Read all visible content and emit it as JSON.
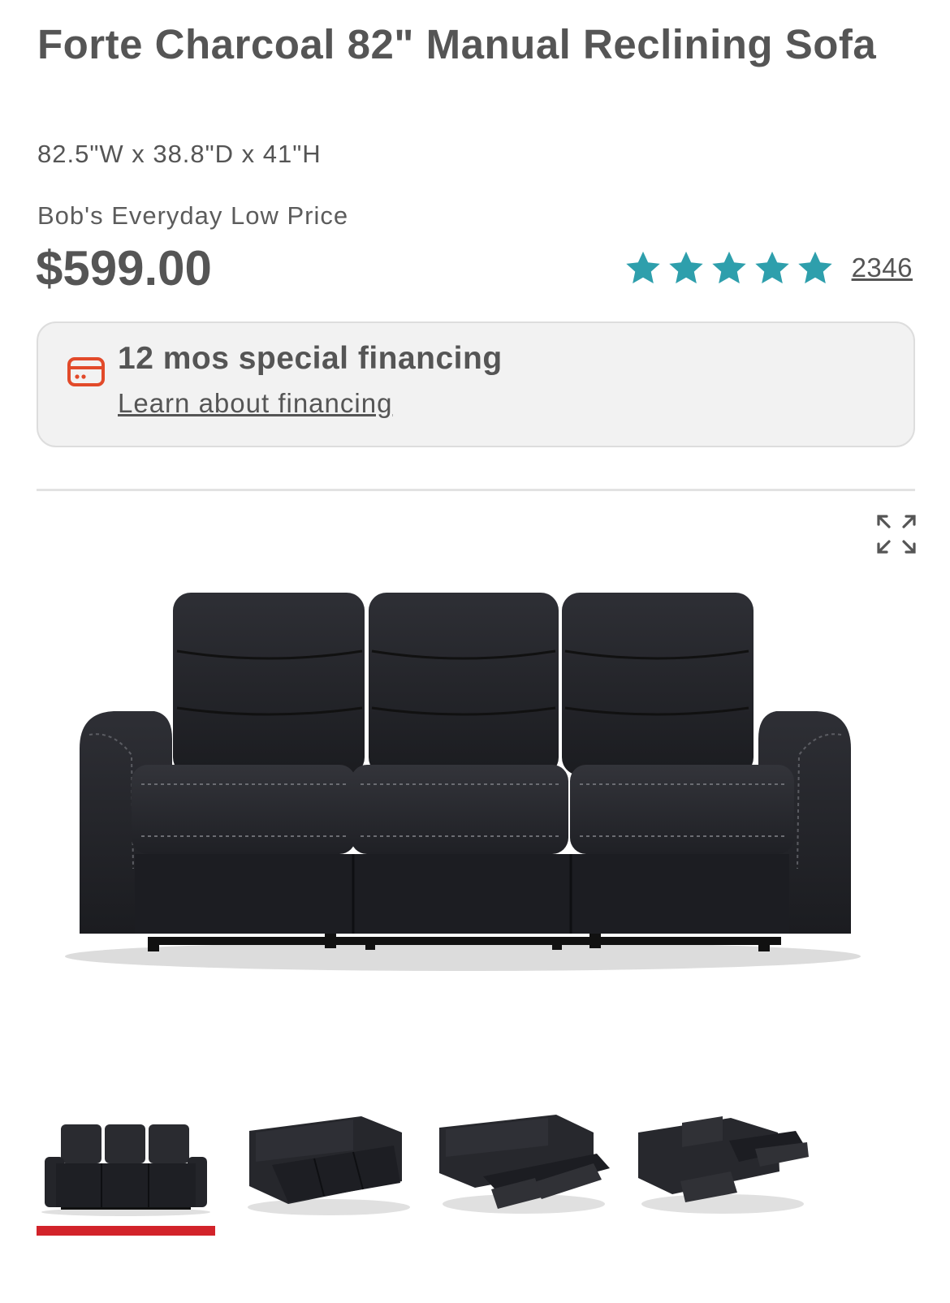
{
  "product": {
    "title": "Forte Charcoal 82\" Manual Reclining Sofa",
    "dimensions": "82.5\"W x 38.8\"D x 41\"H",
    "price_label": "Bob's Everyday Low Price",
    "price": "$599.00",
    "rating": {
      "stars": 5,
      "max": 5,
      "review_count": "2346",
      "star_color": "#2e9fac"
    }
  },
  "financing": {
    "title": "12 mos special financing",
    "link": "Learn about financing",
    "icon": "credit-card-icon",
    "icon_color": "#e24a2a"
  },
  "gallery": {
    "expand_icon": "expand-icon",
    "selected_index": 0,
    "indicator_color": "#d2232a",
    "thumbnails": [
      {
        "name": "thumbnail-front"
      },
      {
        "name": "thumbnail-angle"
      },
      {
        "name": "thumbnail-reclined"
      },
      {
        "name": "thumbnail-reclined-side"
      }
    ]
  }
}
